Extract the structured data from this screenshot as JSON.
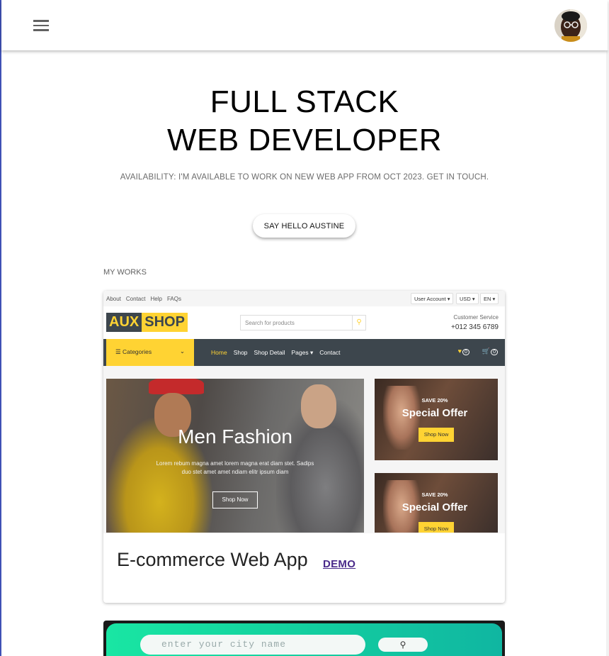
{
  "header": {
    "menu_icon": "hamburger-menu-icon",
    "avatar_alt": "profile-avatar"
  },
  "hero": {
    "title_line1": "FULL STACK",
    "title_line2": "WEB DEVELOPER",
    "availability": "AVAILABILITY: I'M AVAILABLE TO WORK ON NEW WEB APP FROM OCT 2023. GET IN TOUCH.",
    "cta_label": "SAY HELLO AUSTINE"
  },
  "works": {
    "section_label": "MY WORKS",
    "projects": [
      {
        "title": "E-commerce Web App",
        "demo_label": "DEMO",
        "preview": {
          "top_links": [
            "About",
            "Contact",
            "Help",
            "FAQs"
          ],
          "user_account": "User Account ▾",
          "currency": "USD ▾",
          "language": "EN ▾",
          "logo_part1": "AUX",
          "logo_part2": "SHOP",
          "search_placeholder": "Search for products",
          "customer_service_label": "Customer Service",
          "customer_service_phone": "+012 345 6789",
          "categories_label": "☰ Categories",
          "nav_links": [
            "Home",
            "Shop",
            "Shop Detail",
            "Pages ▾",
            "Contact"
          ],
          "wishlist_count": "0",
          "cart_count": "0",
          "banner_title": "Men Fashion",
          "banner_text": "Lorem rebum magna amet lorem magna erat diam stet. Sadips duo stet amet amet ndiam elitr ipsum diam",
          "banner_button": "Shop Now",
          "promo1_save": "SAVE 20%",
          "promo1_title": "Special Offer",
          "promo1_button": "Shop Now",
          "promo2_save": "SAVE 20%",
          "promo2_title": "Special Offer",
          "promo2_button": "Shop Now"
        }
      },
      {
        "preview": {
          "search_placeholder": "enter your city name"
        }
      }
    ]
  },
  "colors": {
    "accent": "#ffd333",
    "dark": "#3d464d",
    "demo_link": "#4a2a8a"
  }
}
